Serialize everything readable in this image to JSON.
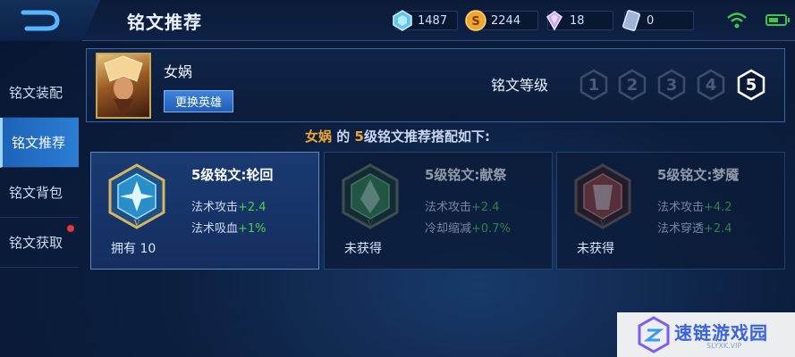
{
  "header": {
    "title": "铭文推荐",
    "back_icon": "back-arrow-icon"
  },
  "resources": [
    {
      "icon": "diamond-gem-icon",
      "value": "1487",
      "color": "#5fc8f2"
    },
    {
      "icon": "gold-coin-icon",
      "value": "2244",
      "color": "#f0a630"
    },
    {
      "icon": "purple-crystal-icon",
      "value": "18",
      "color": "#c9a4f5"
    },
    {
      "icon": "voucher-card-icon",
      "value": "0",
      "color": "#9fb4d8"
    }
  ],
  "status": {
    "wifi_icon": "wifi-icon",
    "battery_icon": "battery-icon",
    "accent": "#3ec64a"
  },
  "sidebar": {
    "items": [
      {
        "label": "铭文装配"
      },
      {
        "label": "铭文推荐"
      },
      {
        "label": "铭文背包"
      },
      {
        "label": "铭文获取"
      }
    ]
  },
  "hero": {
    "name": "女娲",
    "change_button": "更换英雄",
    "level_label": "铭文等级",
    "levels": [
      "1",
      "2",
      "3",
      "4",
      "5"
    ],
    "selected_level": "5"
  },
  "headline": {
    "hero": "女娲",
    "mid": "的",
    "level": "5",
    "tail": "级铭文推荐搭配如下:"
  },
  "cards": [
    {
      "name": "5级铭文:轮回",
      "stat1_label": "法术攻击",
      "stat1_value": "+2.4",
      "stat2_label": "法术吸血",
      "stat2_value": "+1%",
      "owned": "拥有 10",
      "color": "#2a8fc9",
      "icon": "rune-blue-icon"
    },
    {
      "name": "5级铭文:献祭",
      "stat1_label": "法术攻击",
      "stat1_value": "+2.4",
      "stat2_label": "冷却缩减",
      "stat2_value": "+0.7%",
      "owned": "未获得",
      "color": "#3f9a4a",
      "icon": "rune-green-icon"
    },
    {
      "name": "5级铭文:梦魇",
      "stat1_label": "法术攻击",
      "stat1_value": "+4.2",
      "stat2_label": "法术穿透",
      "stat2_value": "+2.4",
      "owned": "未获得",
      "color": "#b0453a",
      "icon": "rune-red-icon"
    }
  ],
  "watermark": {
    "text": "速链游戏园",
    "sub": "SLYXK.VIP"
  }
}
